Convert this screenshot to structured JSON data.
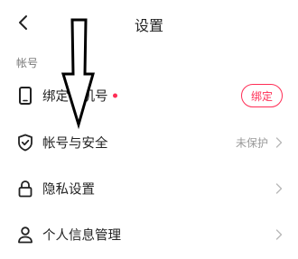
{
  "header": {
    "title": "设置",
    "back_icon": "chevron-left-icon"
  },
  "section": {
    "label": "帐号"
  },
  "rows": [
    {
      "label": "绑定手机号",
      "icon": "phone-icon",
      "has_red_dot": true,
      "action_label": "绑定"
    },
    {
      "label": "帐号与安全",
      "icon": "shield-check-icon",
      "status": "未保护",
      "chevron": true
    },
    {
      "label": "隐私设置",
      "icon": "lock-icon",
      "chevron": true
    },
    {
      "label": "个人信息管理",
      "icon": "user-icon",
      "chevron": true
    }
  ],
  "colors": {
    "accent": "#ff2d55",
    "text": "#222222",
    "muted": "#999999"
  },
  "annotation": {
    "icon": "down-arrow-overlay-icon"
  }
}
